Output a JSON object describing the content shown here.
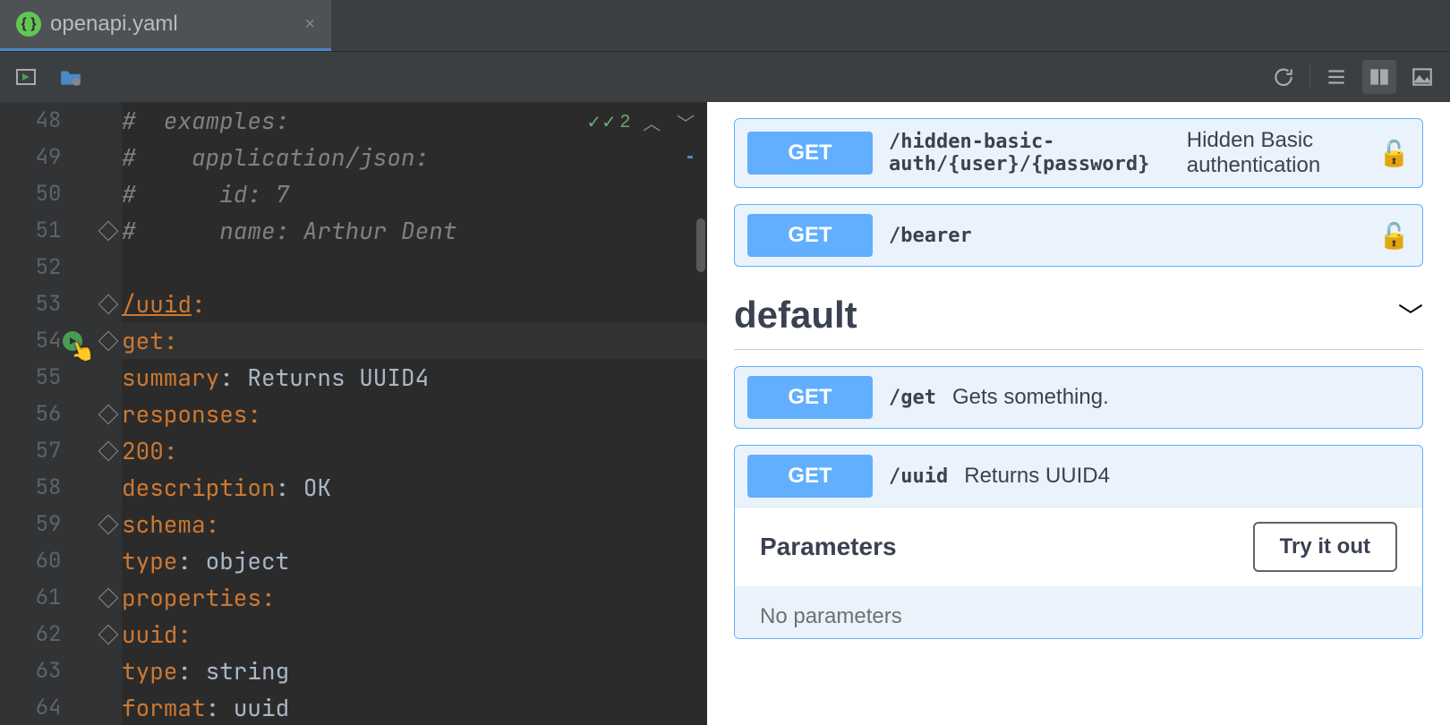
{
  "tab": {
    "filename": "openapi.yaml",
    "close": "×"
  },
  "editor": {
    "badge_count": "2",
    "lines": [
      {
        "n": "48",
        "indent": 8,
        "tokens": [
          {
            "t": "#  examples:",
            "c": "c-comment"
          }
        ]
      },
      {
        "n": "49",
        "indent": 8,
        "tokens": [
          {
            "t": "#    application/json:",
            "c": "c-comment"
          }
        ]
      },
      {
        "n": "50",
        "indent": 8,
        "tokens": [
          {
            "t": "#      id: 7",
            "c": "c-comment"
          }
        ]
      },
      {
        "n": "51",
        "indent": 8,
        "tokens": [
          {
            "t": "#      name: Arthur Dent",
            "c": "c-comment"
          }
        ],
        "fold": true
      },
      {
        "n": "52",
        "indent": 0,
        "tokens": []
      },
      {
        "n": "53",
        "indent": 2,
        "tokens": [
          {
            "t": "/uuid",
            "c": "c-path"
          },
          {
            "t": ":",
            "c": "c-key"
          }
        ],
        "fold": true
      },
      {
        "n": "54",
        "indent": 4,
        "tokens": [
          {
            "t": "get",
            "c": "c-key"
          },
          {
            "t": ":",
            "c": "c-key"
          }
        ],
        "fold": true,
        "current": true,
        "run": true
      },
      {
        "n": "55",
        "indent": 6,
        "tokens": [
          {
            "t": "summary",
            "c": "c-key"
          },
          {
            "t": ": ",
            "c": ""
          },
          {
            "t": "Returns UUID4",
            "c": "c-str"
          }
        ]
      },
      {
        "n": "56",
        "indent": 6,
        "tokens": [
          {
            "t": "responses",
            "c": "c-key"
          },
          {
            "t": ":",
            "c": "c-key"
          }
        ],
        "fold": true
      },
      {
        "n": "57",
        "indent": 8,
        "tokens": [
          {
            "t": "200",
            "c": "c-key"
          },
          {
            "t": ":",
            "c": "c-key"
          }
        ],
        "fold": true
      },
      {
        "n": "58",
        "indent": 10,
        "tokens": [
          {
            "t": "description",
            "c": "c-key"
          },
          {
            "t": ": ",
            "c": ""
          },
          {
            "t": "OK",
            "c": "c-str"
          }
        ]
      },
      {
        "n": "59",
        "indent": 10,
        "tokens": [
          {
            "t": "schema",
            "c": "c-key"
          },
          {
            "t": ":",
            "c": "c-key"
          }
        ],
        "fold": true
      },
      {
        "n": "60",
        "indent": 12,
        "tokens": [
          {
            "t": "type",
            "c": "c-key"
          },
          {
            "t": ": ",
            "c": ""
          },
          {
            "t": "object",
            "c": "c-str"
          }
        ]
      },
      {
        "n": "61",
        "indent": 12,
        "tokens": [
          {
            "t": "properties",
            "c": "c-key"
          },
          {
            "t": ":",
            "c": "c-key"
          }
        ],
        "fold": true
      },
      {
        "n": "62",
        "indent": 14,
        "tokens": [
          {
            "t": "uuid",
            "c": "c-key"
          },
          {
            "t": ":",
            "c": "c-key"
          }
        ],
        "fold": true
      },
      {
        "n": "63",
        "indent": 16,
        "tokens": [
          {
            "t": "type",
            "c": "c-key"
          },
          {
            "t": ": ",
            "c": ""
          },
          {
            "t": "string",
            "c": "c-str"
          }
        ]
      },
      {
        "n": "64",
        "indent": 16,
        "tokens": [
          {
            "t": "format",
            "c": "c-key"
          },
          {
            "t": ": ",
            "c": ""
          },
          {
            "t": "uuid",
            "c": "c-str"
          }
        ]
      }
    ]
  },
  "preview": {
    "section": "default",
    "try_label": "Try it out",
    "params_label": "Parameters",
    "no_params": "No parameters",
    "ops_top": [
      {
        "method": "GET",
        "path": "/hidden-basic-auth/{user}/{password}",
        "summary": "Hidden Basic authentication",
        "lock": true
      },
      {
        "method": "GET",
        "path": "/bearer",
        "summary": "",
        "lock": true
      }
    ],
    "ops_default": [
      {
        "method": "GET",
        "path": "/get",
        "summary": "Gets something."
      },
      {
        "method": "GET",
        "path": "/uuid",
        "summary": "Returns UUID4",
        "expanded": true
      }
    ]
  }
}
